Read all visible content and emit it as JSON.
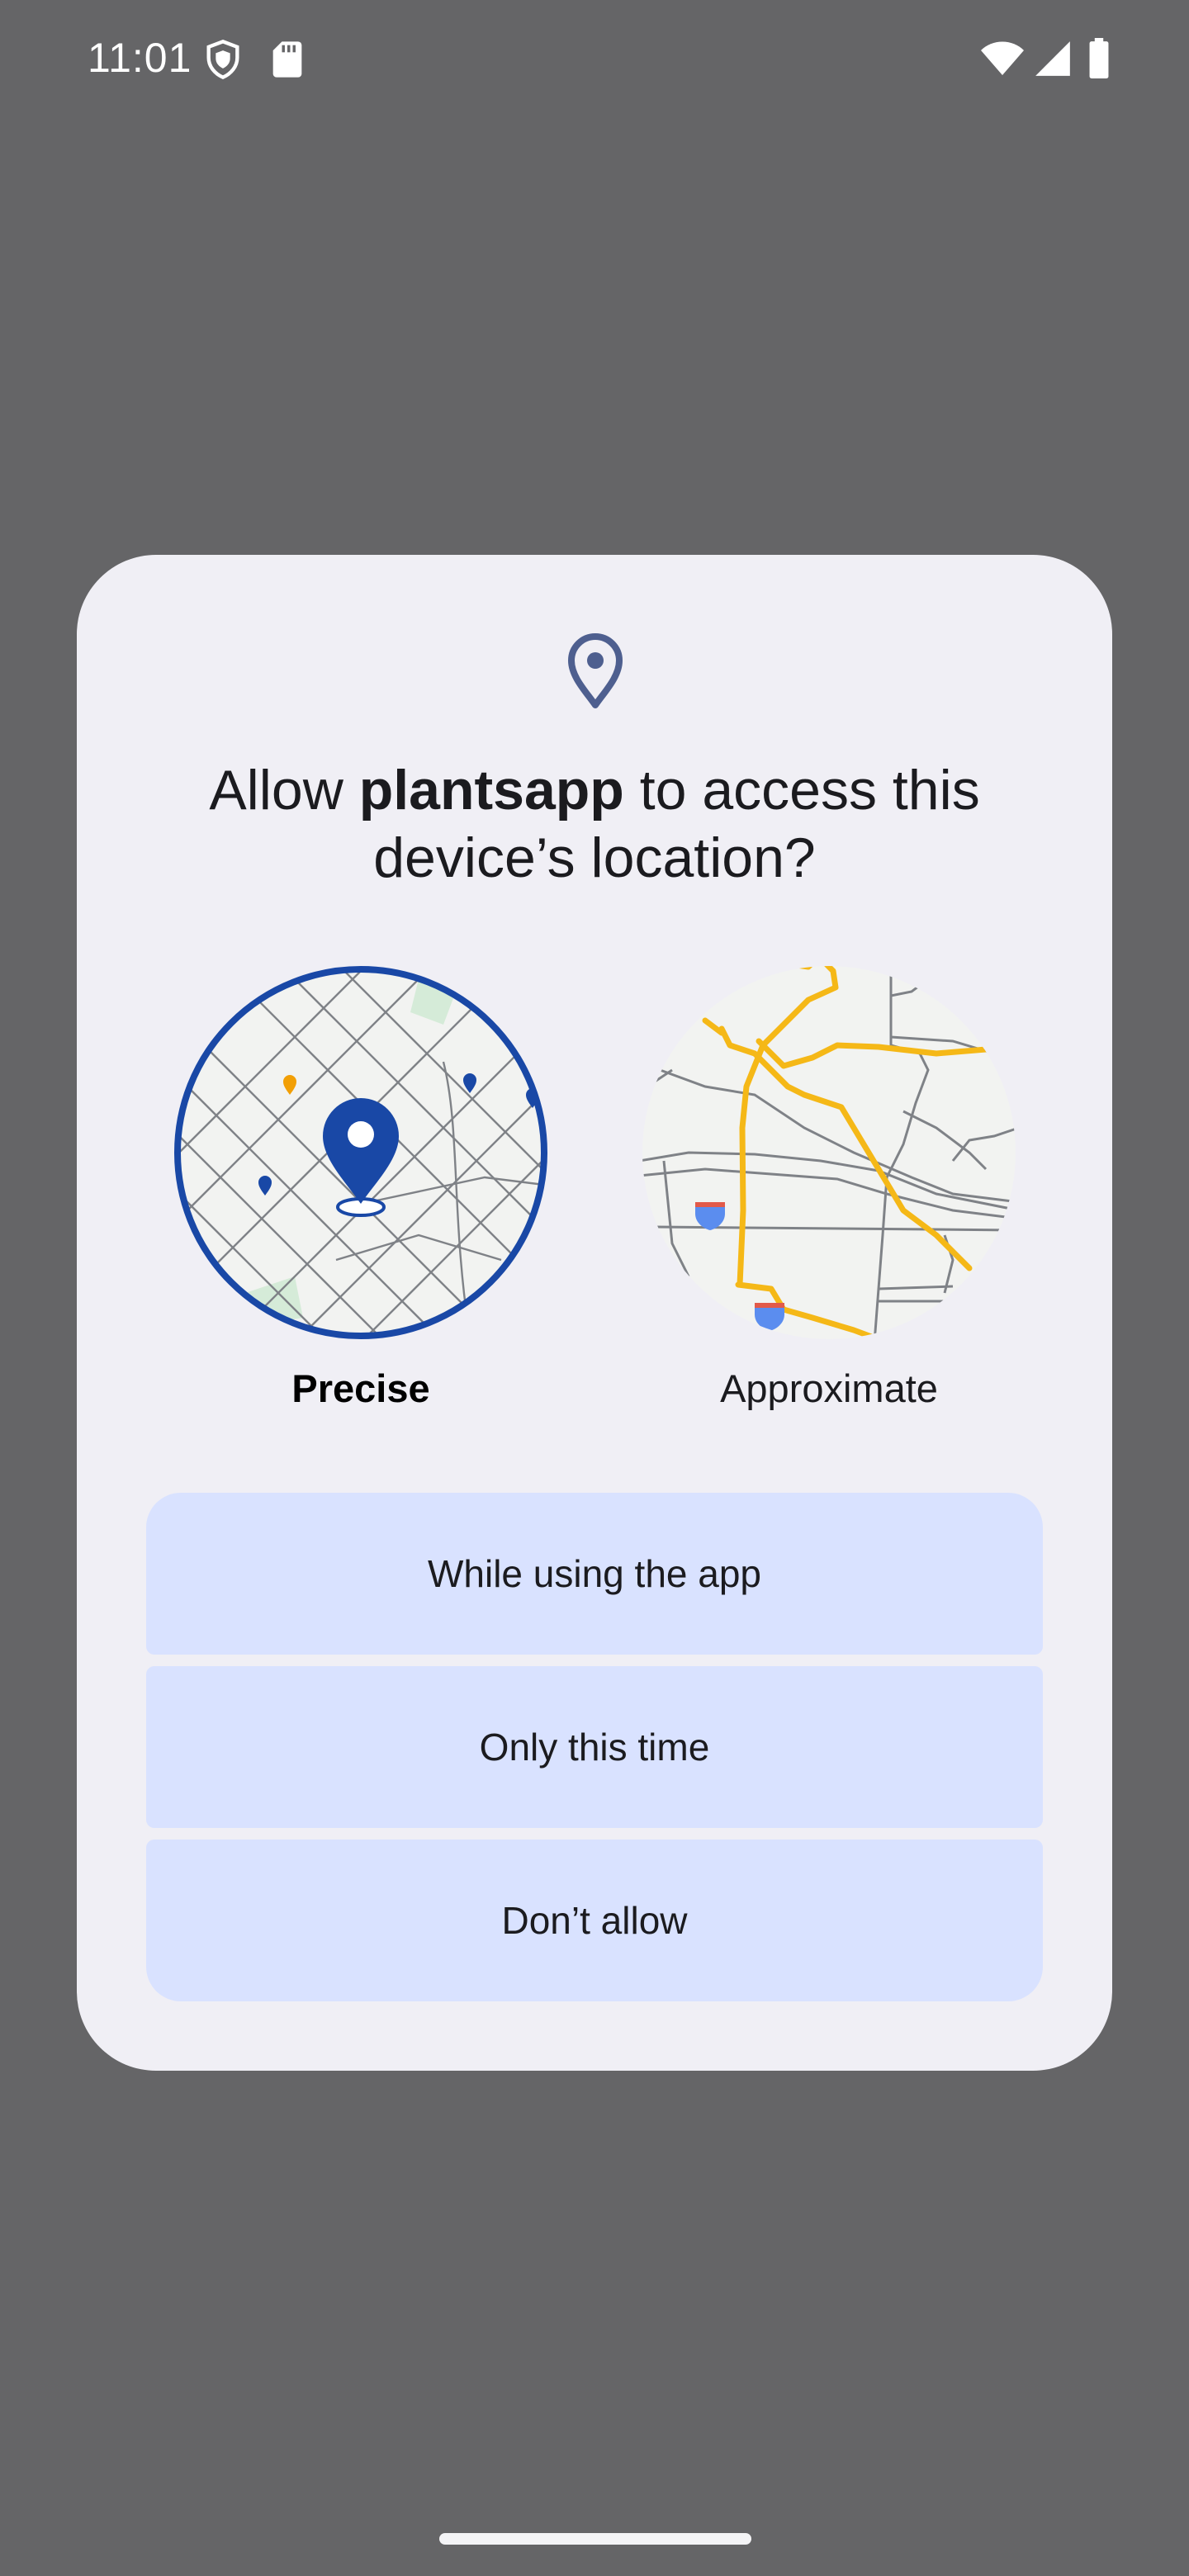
{
  "status_bar": {
    "time": "11:01",
    "left_icons": [
      "shield-icon",
      "sd-card-icon"
    ],
    "right_icons": [
      "wifi-icon",
      "cell-signal-icon",
      "battery-icon"
    ]
  },
  "dialog": {
    "icon": "location-pin-icon",
    "title_prefix": "Allow ",
    "title_app": "plantsapp",
    "title_suffix": " to access this device’s location?",
    "options": [
      {
        "label": "Precise",
        "icon": "precise-map-icon",
        "selected": true
      },
      {
        "label": "Approximate",
        "icon": "approximate-map-icon",
        "selected": false
      }
    ],
    "buttons": [
      {
        "label": "While using the app"
      },
      {
        "label": "Only this time"
      },
      {
        "label": "Don’t allow"
      }
    ]
  },
  "colors": {
    "scrim": "#656567",
    "dialog_surface": "#f0eff5",
    "button_fill": "#d9e2ff",
    "accent_blue": "#1948a6",
    "road_yellow": "#f5b817"
  }
}
